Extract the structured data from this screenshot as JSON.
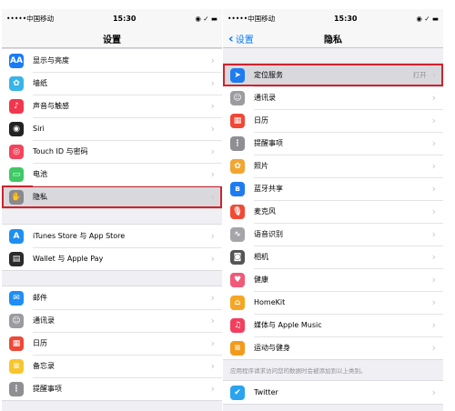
{
  "left": {
    "status": {
      "carrier": "•••••中国移动",
      "time": "15:30"
    },
    "nav_title": "设置",
    "groups": [
      [
        {
          "label": "显示与亮度",
          "icon": "display-icon",
          "glyph": "AA",
          "color": "#1a7cf5"
        },
        {
          "label": "墙纸",
          "icon": "wallpaper-icon",
          "glyph": "✿",
          "color": "#38b4e9"
        },
        {
          "label": "声音与触感",
          "icon": "sound-icon",
          "glyph": "♪",
          "color": "#f1364d"
        },
        {
          "label": "Siri",
          "icon": "siri-icon",
          "glyph": "◉",
          "color": "#222"
        },
        {
          "label": "Touch ID 与密码",
          "icon": "fingerprint-icon",
          "glyph": "◎",
          "color": "#f4445d"
        },
        {
          "label": "电池",
          "icon": "battery-icon",
          "glyph": "▭",
          "color": "#40c864"
        },
        {
          "label": "隐私",
          "icon": "hand-icon",
          "glyph": "✋",
          "color": "#8a8a8e",
          "highlight": true
        }
      ],
      [
        {
          "label": "iTunes Store 与 App Store",
          "icon": "app-store-icon",
          "glyph": "A",
          "color": "#1e8ff0"
        },
        {
          "label": "Wallet 与 Apple Pay",
          "icon": "wallet-icon",
          "glyph": "▤",
          "color": "#2b2b2b"
        }
      ],
      [
        {
          "label": "邮件",
          "icon": "mail-icon",
          "glyph": "✉",
          "color": "#1f8ef6"
        },
        {
          "label": "通讯录",
          "icon": "contacts-icon",
          "glyph": "☺",
          "color": "#9c9ca0"
        },
        {
          "label": "日历",
          "icon": "calendar-icon",
          "glyph": "▦",
          "color": "#f04836"
        },
        {
          "label": "备忘录",
          "icon": "notes-icon",
          "glyph": "≡",
          "color": "#f7c62e"
        },
        {
          "label": "提醒事项",
          "icon": "reminders-icon",
          "glyph": "⋮",
          "color": "#8e8e93"
        }
      ]
    ]
  },
  "right": {
    "status": {
      "carrier": "•••••中国移动",
      "time": "15:30"
    },
    "nav_title": "隐私",
    "back_label": "设置",
    "groups": [
      [
        {
          "label": "定位服务",
          "value": "打开",
          "icon": "location-icon",
          "glyph": "➤",
          "color": "#1f7cf0",
          "highlight": true
        },
        {
          "label": "通讯录",
          "icon": "contacts-icon",
          "glyph": "☺",
          "color": "#9c9ca0"
        },
        {
          "label": "日历",
          "icon": "calendar-icon",
          "glyph": "▦",
          "color": "#f04836"
        },
        {
          "label": "提醒事项",
          "icon": "reminders-icon",
          "glyph": "⋮",
          "color": "#8e8e93"
        },
        {
          "label": "照片",
          "icon": "photos-icon",
          "glyph": "✿",
          "color": "#f2a530"
        },
        {
          "label": "蓝牙共享",
          "icon": "bluetooth-icon",
          "glyph": "ʙ",
          "color": "#1e7cf0"
        },
        {
          "label": "麦克风",
          "icon": "microphone-icon",
          "glyph": "🎙",
          "color": "#f04a35"
        },
        {
          "label": "语音识别",
          "icon": "speech-recognition-icon",
          "glyph": "∿",
          "color": "#a5a5aa"
        },
        {
          "label": "相机",
          "icon": "camera-icon",
          "glyph": "◙",
          "color": "#555"
        },
        {
          "label": "健康",
          "icon": "health-icon",
          "glyph": "♥",
          "color": "#f05a78"
        },
        {
          "label": "HomeKit",
          "icon": "home-icon",
          "glyph": "⌂",
          "color": "#f5a623"
        },
        {
          "label": "媒体与 Apple Music",
          "icon": "music-icon",
          "glyph": "♫",
          "color": "#f23f5e"
        },
        {
          "label": "运动与健身",
          "icon": "motion-icon",
          "glyph": "≡",
          "color": "#f39a1c"
        }
      ]
    ],
    "footnote": "应用程序请求访问您的数据时会被添加到以上类别。",
    "bottom_group": [
      {
        "label": "Twitter",
        "icon": "twitter-icon",
        "glyph": "✔",
        "color": "#2aa4ee"
      }
    ]
  }
}
